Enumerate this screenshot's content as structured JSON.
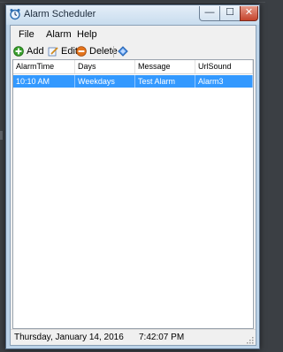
{
  "window": {
    "title": "Alarm Scheduler"
  },
  "title_controls": {
    "minimize": "—",
    "maximize": "☐",
    "close": "✕"
  },
  "menu": [
    "File",
    "Alarm",
    "Help"
  ],
  "toolbar": {
    "add": "Add",
    "edit": "Edit",
    "delete": "Delete"
  },
  "columns": [
    "AlarmTime",
    "Days",
    "Message",
    "UrlSound"
  ],
  "rows": [
    {
      "time": "10:10 AM",
      "days": "Weekdays",
      "message": "Test Alarm",
      "sound": "Alarm3"
    }
  ],
  "status": {
    "date": "Thursday, January 14, 2016",
    "time": "7:42:07 PM"
  },
  "colors": {
    "selection": "#3399ff",
    "titlebar": "#c8dcee",
    "close": "#c5432b"
  }
}
